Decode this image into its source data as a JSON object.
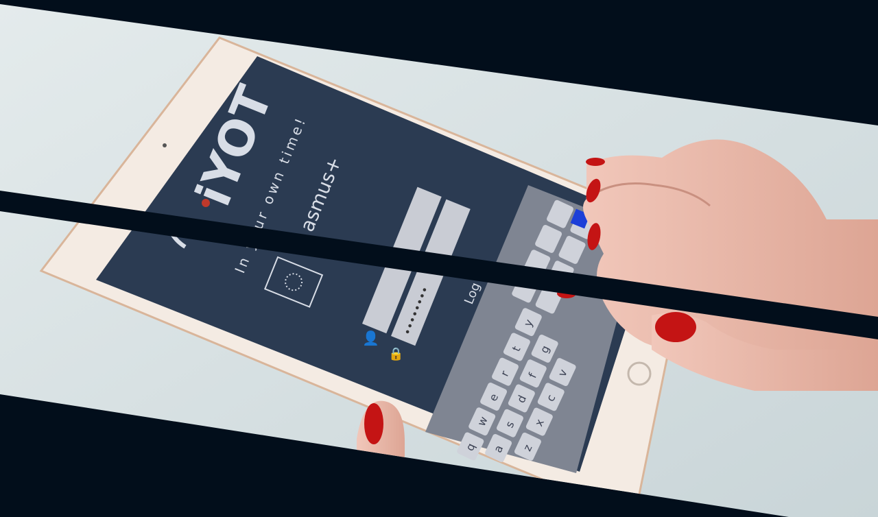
{
  "app": {
    "logo_text": "iYOT",
    "tagline": "In your own time!",
    "partner_text": "asmus+",
    "login_label": "Log in",
    "password_mask": "••••••••"
  },
  "keyboard": {
    "keys": [
      "q",
      "w",
      "e",
      "r",
      "t",
      "y",
      "a",
      "s",
      "d",
      "f",
      "g",
      "z",
      "x",
      "c",
      "v"
    ]
  },
  "colors": {
    "background_dark": "#020e1b",
    "screen_dark": "#2b3b52",
    "nail_red": "#c41414",
    "tablet_frame": "#f4ebe3",
    "key_blue": "#1c3fd8"
  }
}
